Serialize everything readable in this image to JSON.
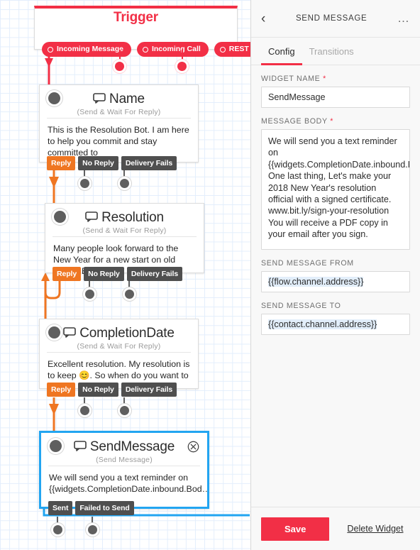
{
  "canvas": {
    "trigger": {
      "title": "Trigger",
      "pills": [
        {
          "label": "Incoming Message"
        },
        {
          "label": "Incoming Call"
        },
        {
          "label": "REST API"
        }
      ]
    },
    "nodes": [
      {
        "title": "Name",
        "subtitle": "(Send & Wait For Reply)",
        "body": "This is the Resolution Bot. I am here to help you commit and stay committed to",
        "outputs": [
          {
            "label": "Reply",
            "active": true
          },
          {
            "label": "No Reply",
            "active": false
          },
          {
            "label": "Delivery Fails",
            "active": false
          }
        ]
      },
      {
        "title": "Resolution",
        "subtitle": "(Send & Wait For Reply)",
        "body": "Many people look forward to the New Year for a new start on old habits. But",
        "outputs": [
          {
            "label": "Reply",
            "active": true
          },
          {
            "label": "No Reply",
            "active": false
          },
          {
            "label": "Delivery Fails",
            "active": false
          }
        ]
      },
      {
        "title": "CompletionDate",
        "subtitle": "(Send & Wait For Reply)",
        "body": "Excellent resolution. My resolution is to keep 😊. So when do you want to",
        "outputs": [
          {
            "label": "Reply",
            "active": true
          },
          {
            "label": "No Reply",
            "active": false
          },
          {
            "label": "Delivery Fails",
            "active": false
          }
        ]
      },
      {
        "title": "SendMessage",
        "subtitle": "(Send Message)",
        "body": "We will send you a text reminder on {{widgets.CompletionDate.inbound.Bod…",
        "outputs": [
          {
            "label": "Sent",
            "active": false
          },
          {
            "label": "Failed to Send",
            "active": false
          }
        ]
      }
    ]
  },
  "panel": {
    "title": "SEND MESSAGE",
    "back_icon": "‹",
    "more_icon": "…",
    "tabs": [
      {
        "label": "Config",
        "active": true
      },
      {
        "label": "Transitions",
        "active": false
      }
    ],
    "fields": {
      "widget_name_label": "WIDGET NAME",
      "widget_name_value": "SendMessage",
      "message_body_label": "MESSAGE BODY",
      "message_body_value": "We will send you a text reminder on {{widgets.CompletionDate.inbound.Body}}.\nOne last thing, Let's make your 2018 New Year's resolution official with a signed certificate. www.bit.ly/sign-your-resolution You will receive a PDF copy in your email after you sign.",
      "send_from_label": "SEND MESSAGE FROM",
      "send_from_value": "{{flow.channel.address}}",
      "send_to_label": "SEND MESSAGE TO",
      "send_to_value": "{{contact.channel.address}}",
      "required_mark": "*"
    },
    "footer": {
      "save_label": "Save",
      "delete_label": "Delete Widget"
    }
  },
  "colors": {
    "brand_red": "#f22f46",
    "accent_orange": "#ef7622",
    "selected_blue": "#22a5f1",
    "port_gray": "#5f5f5f"
  }
}
